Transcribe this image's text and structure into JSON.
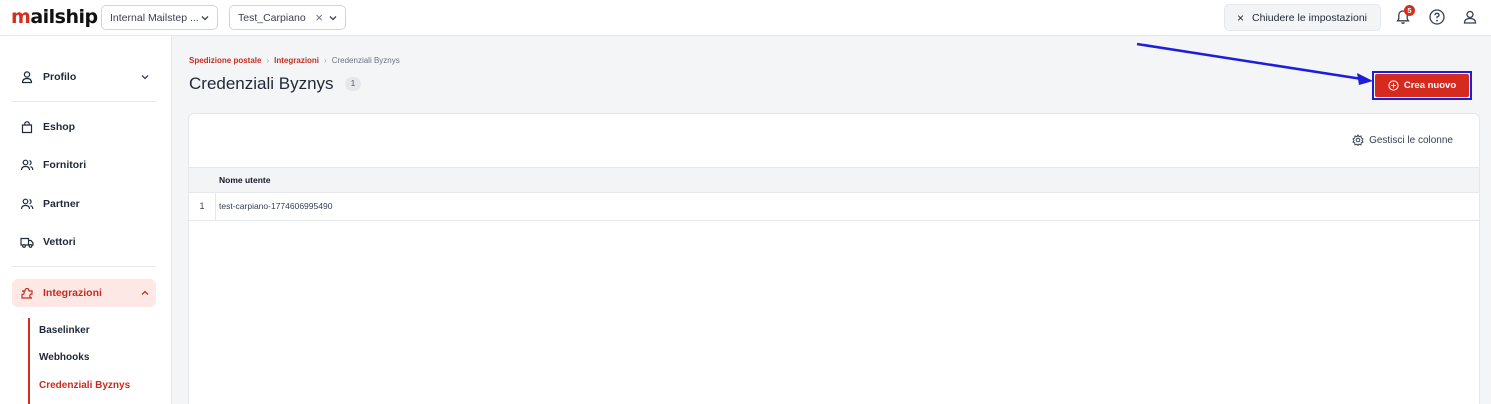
{
  "topbar": {
    "logo": "mailship",
    "org_select": "Internal Mailstep ...",
    "client_select": "Test_Carpiano",
    "close_settings_label": "Chiudere le impostazioni",
    "notification_count": "5"
  },
  "sidebar": {
    "items": [
      {
        "label": "Profilo",
        "icon": "user-icon"
      },
      {
        "label": "Eshop",
        "icon": "shopping-bag-icon"
      },
      {
        "label": "Fornitori",
        "icon": "users-icon"
      },
      {
        "label": "Partner",
        "icon": "partner-icon"
      },
      {
        "label": "Vettori",
        "icon": "truck-icon"
      },
      {
        "label": "Integrazioni",
        "icon": "puzzle-icon"
      }
    ],
    "subitems": [
      {
        "label": "Baselinker"
      },
      {
        "label": "Webhooks"
      },
      {
        "label": "Credenziali Byznys"
      }
    ]
  },
  "breadcrumb": {
    "items": [
      "Spedizione postale",
      "Integrazioni",
      "Credenziali Byznys"
    ]
  },
  "page": {
    "title": "Credenziali Byznys",
    "count": "1",
    "create_label": "Crea nuovo",
    "manage_columns_label": "Gestisci le colonne"
  },
  "table": {
    "columns": [
      "Nome utente"
    ],
    "rows": [
      {
        "index": "1",
        "username": "test-carpiano-1774606995490"
      }
    ]
  },
  "colors": {
    "accent": "#d52b1e",
    "annotation": "#1d1ddb"
  }
}
